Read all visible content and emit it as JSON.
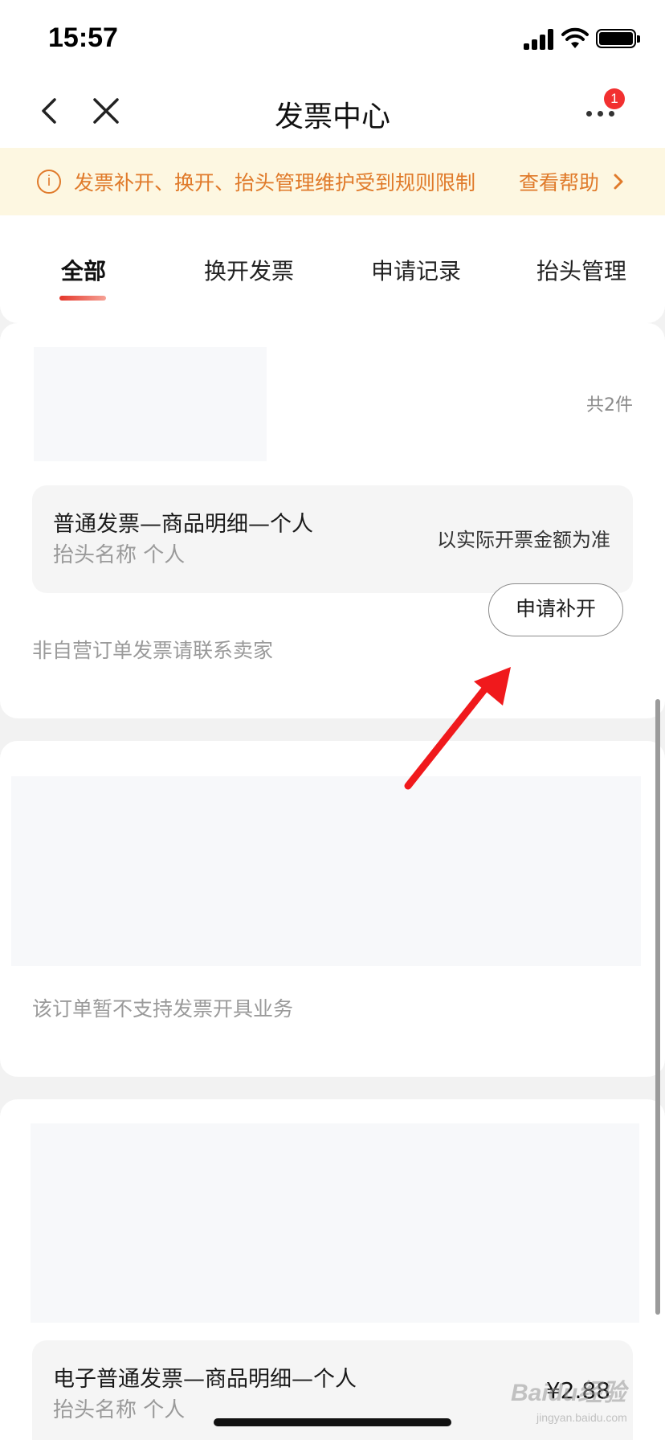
{
  "status_bar": {
    "time": "15:57"
  },
  "nav": {
    "title": "发票中心",
    "badge_count": "1"
  },
  "notice": {
    "icon_glyph": "i",
    "text": "发票补开、换开、抬头管理维护受到规则限制",
    "link": "查看帮助"
  },
  "tabs": [
    {
      "label": "全部",
      "active": true
    },
    {
      "label": "换开发票",
      "active": false
    },
    {
      "label": "申请记录",
      "active": false
    },
    {
      "label": "抬头管理",
      "active": false
    }
  ],
  "order1": {
    "count": "共2件",
    "invoice_type": "普通发票—商品明细—个人",
    "invoice_title": "抬头名称  个人",
    "amount_note": "以实际开票金额为准",
    "hint": "非自营订单发票请联系卖家",
    "button": "申请补开"
  },
  "order2": {
    "hint": "该订单暂不支持发票开具业务"
  },
  "order3": {
    "invoice_type": "电子普通发票—商品明细—个人",
    "invoice_title": "抬头名称  个人",
    "amount": "¥2.88"
  },
  "watermark": {
    "text": "Baidu经验",
    "url": "jingyan.baidu.com"
  },
  "colors": {
    "accent": "#e4362a",
    "notice_text": "#e07a2a",
    "notice_bg": "#fdf7e1",
    "annotation_arrow": "#f0191c"
  }
}
